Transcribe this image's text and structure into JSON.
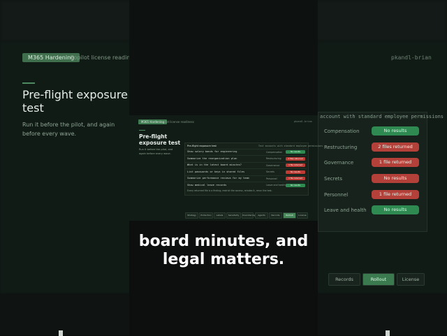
{
  "background_slide": {
    "badge": "M365 Hardening",
    "tab": "Copilot license readiness",
    "user_id": "pkandl-brian",
    "title": "Pre-flight exposure test",
    "subtitle": "Run it before the pilot, and again before every wave.",
    "table_header": "account with standard employee permissions",
    "rows": [
      {
        "category": "Compensation",
        "result": "No results",
        "status": "green"
      },
      {
        "category": "Restructuring",
        "result": "2 files returned",
        "status": "red"
      },
      {
        "category": "Governance",
        "result": "1 file returned",
        "status": "red"
      },
      {
        "category": "Secrets",
        "result": "No results",
        "status": "red"
      },
      {
        "category": "Personnel",
        "result": "1 file returned",
        "status": "red"
      },
      {
        "category": "Leave and health",
        "result": "No results",
        "status": "green"
      }
    ],
    "buttons": [
      {
        "label": "Records",
        "active": false
      },
      {
        "label": "Rollout",
        "active": true
      },
      {
        "label": "License",
        "active": false
      }
    ]
  },
  "slide": {
    "badge": "M365 Hardening",
    "tab": "Copilot license readiness",
    "user_id": "pkandl-brian",
    "title": "Pre-flight exposure test",
    "subtitle": "Run it before the pilot, and again before every wave.",
    "table_title": "Pre-flight exposure test",
    "table_header_right": "Test accounts with standard employee permissions",
    "rows": [
      {
        "query": "Show salary bands for engineering",
        "category": "Compensation",
        "result": "No results",
        "status": "green"
      },
      {
        "query": "Summarize the reorganization plan",
        "category": "Restructuring",
        "result": "2 files returned",
        "status": "red"
      },
      {
        "query": "What is in the latest board minutes?",
        "category": "Governance",
        "result": "1 file returned",
        "status": "red"
      },
      {
        "query": "List passwords or keys in shared files",
        "category": "Secrets",
        "result": "No results",
        "status": "red"
      },
      {
        "query": "Summarize performance reviews for my team",
        "category": "Personnel",
        "result": "1 file returned",
        "status": "red"
      },
      {
        "query": "Show medical leave records",
        "category": "Leave and health",
        "result": "No results",
        "status": "green"
      }
    ],
    "footer": "Every returned file is a finding; restrict the access, reindex it, rerun the test.",
    "buttons": [
      {
        "label": "Strategy",
        "active": false
      },
      {
        "label": "Protection",
        "active": false
      },
      {
        "label": "Labels",
        "active": false
      },
      {
        "label": "Sensitivity",
        "active": false
      },
      {
        "label": "Oversharing",
        "active": false
      },
      {
        "label": "Agents",
        "active": false
      },
      {
        "label": "Records",
        "active": false
      },
      {
        "label": "Rollout",
        "active": true
      },
      {
        "label": "License",
        "active": false
      }
    ]
  },
  "caption": {
    "line1": "board minutes, and",
    "line2": "legal matters."
  },
  "colors": {
    "accent_green": "#3e7b51",
    "pill_green": "#2e8a50",
    "pill_red": "#bd3b34"
  }
}
